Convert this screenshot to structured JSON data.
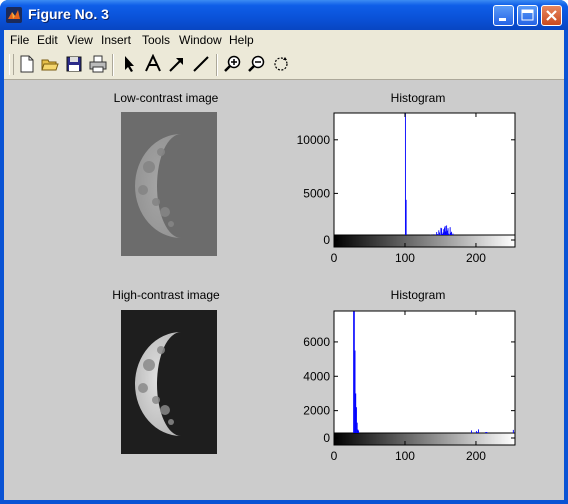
{
  "window": {
    "title": "Figure No. 3"
  },
  "menu": [
    "File",
    "Edit",
    "View",
    "Insert",
    "Tools",
    "Window",
    "Help"
  ],
  "toolbar": {
    "icons": [
      "new-file-icon",
      "open-folder-icon",
      "save-icon",
      "print-icon",
      "select-arrow-icon",
      "insert-text-icon",
      "insert-arrow-icon",
      "insert-line-icon",
      "zoom-in-icon",
      "zoom-out-icon",
      "rotate-3d-icon"
    ]
  },
  "figure": {
    "panel1_title": "Low-contrast image",
    "panel2_title": "Histogram",
    "panel3_title": "High-contrast image",
    "panel4_title": "Histogram"
  },
  "chart_data": [
    {
      "type": "bar",
      "title": "Histogram",
      "xlim": [
        0,
        255
      ],
      "ylim": [
        0,
        12500
      ],
      "xticks": [
        0,
        100,
        200
      ],
      "yticks": [
        0,
        5000,
        10000
      ],
      "color": "#0000ff",
      "peaks": [
        {
          "x": 100,
          "y": 12500
        },
        {
          "x": 101,
          "y": 4400
        },
        {
          "x": 102,
          "y": 1000
        }
      ],
      "profile": [
        [
          103,
          100
        ],
        [
          120,
          500
        ],
        [
          140,
          900
        ],
        [
          155,
          1500
        ],
        [
          165,
          1300
        ],
        [
          170,
          700
        ],
        [
          175,
          1000
        ],
        [
          178,
          200
        ],
        [
          180,
          0
        ]
      ]
    },
    {
      "type": "bar",
      "title": "Histogram",
      "xlim": [
        0,
        255
      ],
      "ylim": [
        0,
        7800
      ],
      "xticks": [
        0,
        100,
        200
      ],
      "yticks": [
        0,
        2000,
        4000,
        6000
      ],
      "color": "#0000ff",
      "peaks": [
        {
          "x": 27,
          "y": 7800
        },
        {
          "x": 28,
          "y": 7800
        },
        {
          "x": 29,
          "y": 5500
        },
        {
          "x": 30,
          "y": 3000
        },
        {
          "x": 31,
          "y": 2200
        },
        {
          "x": 32,
          "y": 1300
        },
        {
          "x": 33,
          "y": 900
        }
      ],
      "profile": [
        [
          34,
          600
        ],
        [
          40,
          300
        ],
        [
          60,
          200
        ],
        [
          100,
          300
        ],
        [
          150,
          350
        ],
        [
          180,
          500
        ],
        [
          200,
          650
        ],
        [
          220,
          500
        ],
        [
          240,
          250
        ],
        [
          250,
          400
        ],
        [
          253,
          800
        ],
        [
          255,
          0
        ]
      ]
    }
  ]
}
